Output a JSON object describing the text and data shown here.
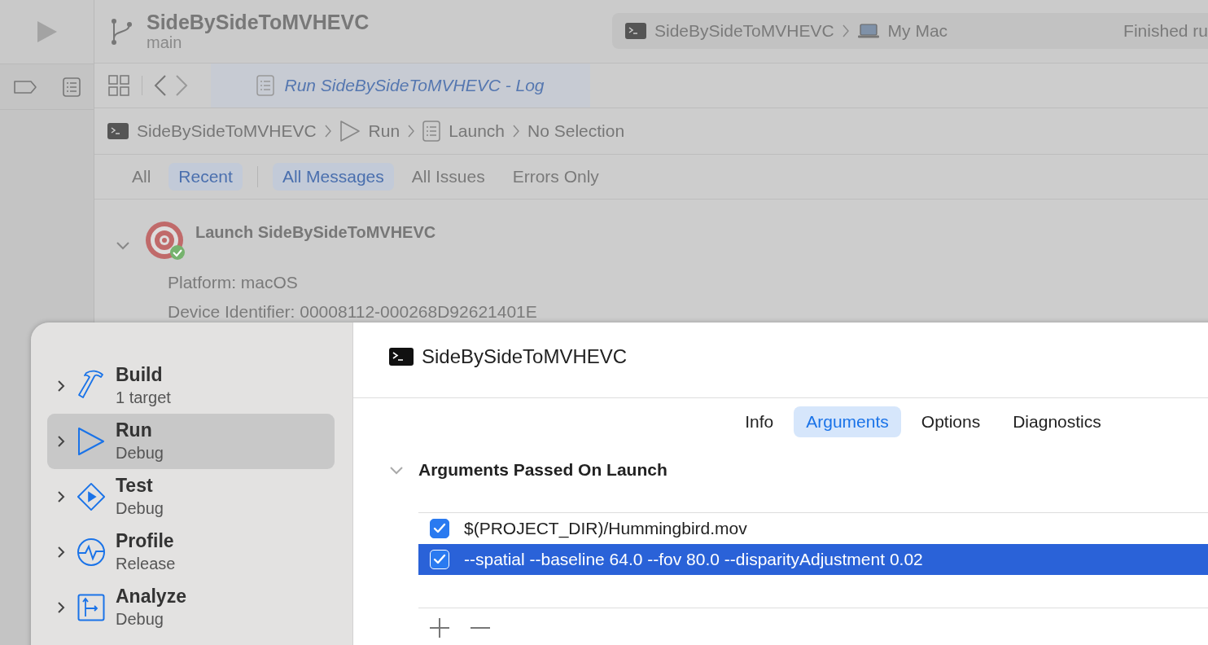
{
  "toolbar": {
    "scheme_title": "SideBySideToMVHEVC",
    "branch": "main",
    "destination": {
      "scheme": "SideBySideToMVHEVC",
      "device": "My Mac"
    },
    "status": "Finished ru"
  },
  "editor_tab": {
    "title": "Run SideBySideToMVHEVC - Log"
  },
  "breadcrumb": [
    {
      "kind": "terminal",
      "label": "SideBySideToMVHEVC"
    },
    {
      "kind": "run",
      "label": "Run"
    },
    {
      "kind": "log",
      "label": "Launch"
    },
    {
      "kind": "none",
      "label": "No Selection"
    }
  ],
  "filters": {
    "scope": [
      {
        "label": "All",
        "selected": false
      },
      {
        "label": "Recent",
        "selected": true
      }
    ],
    "types": [
      {
        "label": "All Messages",
        "selected": true
      },
      {
        "label": "All Issues",
        "selected": false
      },
      {
        "label": "Errors Only",
        "selected": false
      }
    ]
  },
  "log": {
    "title": "Launch SideBySideToMVHEVC",
    "expanded": true,
    "lines": [
      "Platform: macOS",
      "Device Identifier: 00008112-000268D92621401E"
    ]
  },
  "scheme_sheet": {
    "actions": [
      {
        "kind": "build",
        "title": "Build",
        "subtitle": "1 target",
        "selected": false
      },
      {
        "kind": "run",
        "title": "Run",
        "subtitle": "Debug",
        "selected": true
      },
      {
        "kind": "test",
        "title": "Test",
        "subtitle": "Debug",
        "selected": false
      },
      {
        "kind": "profile",
        "title": "Profile",
        "subtitle": "Release",
        "selected": false
      },
      {
        "kind": "analyze",
        "title": "Analyze",
        "subtitle": "Debug",
        "selected": false
      }
    ],
    "target": "SideBySideToMVHEVC",
    "tabs": [
      {
        "label": "Info",
        "selected": false
      },
      {
        "label": "Arguments",
        "selected": true
      },
      {
        "label": "Options",
        "selected": false
      },
      {
        "label": "Diagnostics",
        "selected": false
      }
    ],
    "section": {
      "title": "Arguments Passed On Launch",
      "expanded": true
    },
    "arguments": [
      {
        "text": "$(PROJECT_DIR)/Hummingbird.mov",
        "checked": true,
        "selected": false
      },
      {
        "text": "--spatial --baseline 64.0 --fov 80.0 --disparityAdjustment 0.02",
        "checked": true,
        "selected": true
      }
    ]
  }
}
